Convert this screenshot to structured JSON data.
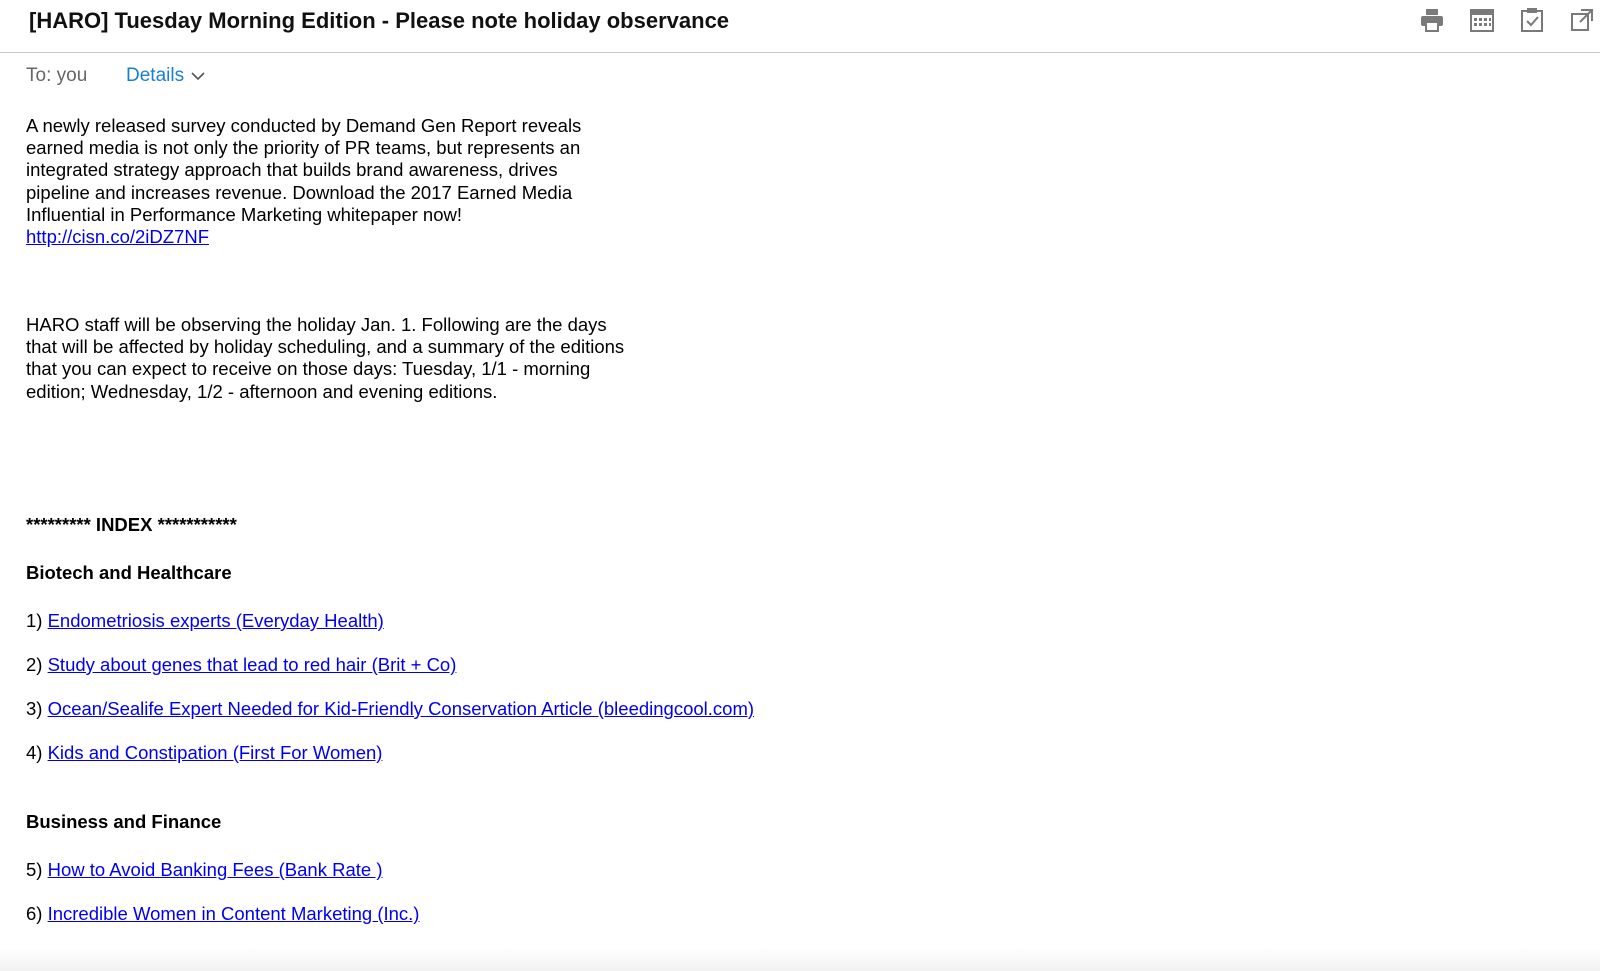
{
  "email": {
    "subject": "[HARO] Tuesday Morning Edition - Please note holiday observance",
    "to_label": "To: you",
    "details_label": "Details"
  },
  "toolbar": {
    "icons": [
      "print-icon",
      "calendar-icon",
      "task-icon",
      "popout-icon"
    ]
  },
  "body": {
    "para1_text": "A newly released survey conducted by Demand Gen Report reveals earned media is not only the priority of PR teams, but represents an integrated strategy approach that builds brand awareness, drives pipeline and increases revenue. Download the 2017 Earned Media Influential in Performance Marketing whitepaper now! ",
    "para1_link": "http://cisn.co/2iDZ7NF",
    "para2_text": "HARO staff will be observing the holiday Jan. 1. Following are the days that will be affected by holiday scheduling, and a summary of the editions that you can expect to receive on those days: Tuesday, 1/1 - morning edition; Wednesday, 1/2 - afternoon and evening editions."
  },
  "index": {
    "title": "********* INDEX ***********",
    "sections": [
      {
        "heading": "Biotech and Healthcare",
        "items": [
          {
            "num": "1) ",
            "text": "Endometriosis experts (Everyday Health) "
          },
          {
            "num": "2) ",
            "text": "Study about genes that lead to red hair (Brit + Co) "
          },
          {
            "num": "3) ",
            "text": "Ocean/Sealife Expert Needed for Kid-Friendly Conservation Article (bleedingcool.com) "
          },
          {
            "num": "4) ",
            "text": "Kids and Constipation (First For Women) "
          }
        ]
      },
      {
        "heading": "Business and Finance",
        "items": [
          {
            "num": "5) ",
            "text": "How to Avoid Banking Fees (Bank Rate ) "
          },
          {
            "num": "6) ",
            "text": "Incredible Women in Content Marketing (Inc.) "
          }
        ]
      }
    ]
  },
  "colors": {
    "link": "#0000ee",
    "details": "#1a7fd1",
    "icon": "#7a7a7a"
  }
}
